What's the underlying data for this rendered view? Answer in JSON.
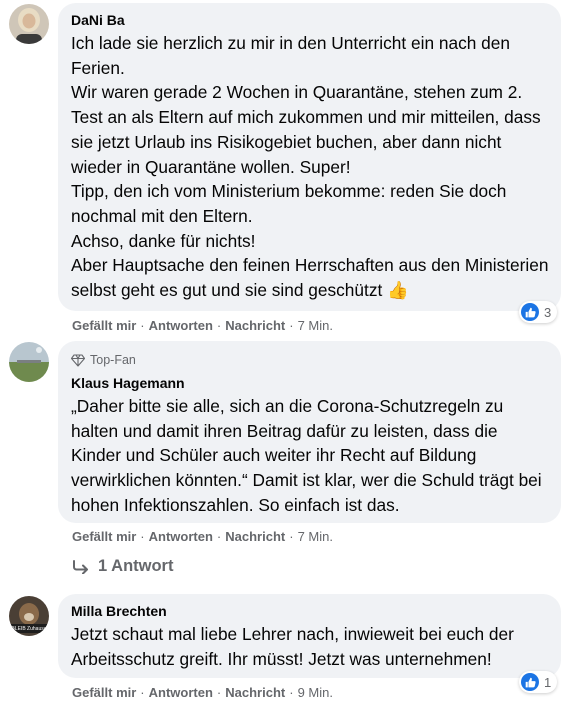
{
  "comments": [
    {
      "author": "DaNi Ba",
      "lines": [
        "Ich lade sie herzlich zu mir in den Unterricht ein nach den Ferien.",
        "Wir waren gerade 2 Wochen in Quarantäne, stehen zum 2. Test an als Eltern auf mich zukommen und mir mitteilen, dass sie jetzt Urlaub ins Risikogebiet buchen, aber dann nicht wieder in Quarantäne wollen. Super!",
        "Tipp, den ich vom Ministerium bekomme: reden Sie doch nochmal mit den Eltern.",
        "Achso, danke für nichts!",
        "Aber Hauptsache den feinen Herrschaften aus den Ministerien selbst geht es gut und sie sind geschützt"
      ],
      "emoji": "👍",
      "reaction_count": "3",
      "actions": {
        "like": "Gefällt mir",
        "reply": "Antworten",
        "message": "Nachricht",
        "time": "7 Min."
      }
    },
    {
      "badge": "Top-Fan",
      "author": "Klaus Hagemann",
      "lines": [
        "„Daher bitte sie alle, sich an die Corona-Schutzregeln zu halten und damit ihren Beitrag dafür zu leisten, dass die Kinder und Schüler auch weiter ihr Recht auf Bildung verwirklichen könnten.“ Damit ist klar, wer die Schuld trägt bei hohen Infektionszahlen. So einfach ist das."
      ],
      "actions": {
        "like": "Gefällt mir",
        "reply": "Antworten",
        "message": "Nachricht",
        "time": "7 Min."
      },
      "replies_label": "1 Antwort"
    },
    {
      "author": "Milla Brechten",
      "avatar_text": "BLEIB Zuhause",
      "lines": [
        "Jetzt schaut mal liebe Lehrer nach, inwieweit bei euch der Arbeitsschutz greift. Ihr müsst! Jetzt was unternehmen!"
      ],
      "reaction_count": "1",
      "actions": {
        "like": "Gefällt mir",
        "reply": "Antworten",
        "message": "Nachricht",
        "time": "9 Min."
      }
    }
  ],
  "colors": {
    "bubble": "#f0f2f5",
    "secondary_text": "#65676b",
    "like_blue": "#1b74e4"
  }
}
